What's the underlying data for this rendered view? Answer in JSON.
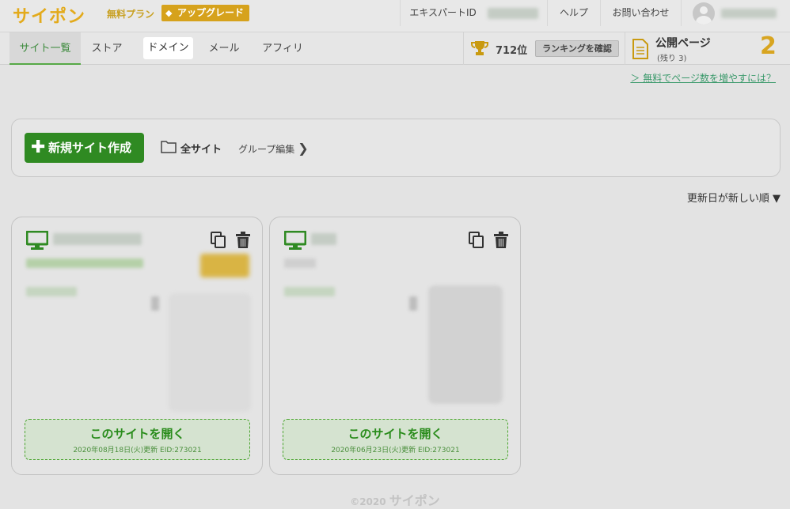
{
  "header": {
    "logo": "サイポン",
    "plan": "無料プラン",
    "upgrade": "アップグレード",
    "expert_id_label": "エキスパートID",
    "help": "ヘルプ",
    "contact": "お問い合わせ"
  },
  "nav": {
    "tabs": [
      {
        "label": "サイト一覧"
      },
      {
        "label": "ストア"
      },
      {
        "label": "ドメイン"
      },
      {
        "label": "メール"
      },
      {
        "label": "アフィリ"
      }
    ],
    "rank_value": "712位",
    "rank_button": "ランキングを確認",
    "published_title": "公開ページ",
    "published_remaining": "(残り 3)",
    "published_count": "2"
  },
  "help_link": "＞ 無料でページ数を増やすには？",
  "toolbar": {
    "new_site": "新規サイト作成",
    "all_sites": "全サイト",
    "group_edit": "グループ編集"
  },
  "sort_label": "更新日が新しい順 ▼",
  "cards": [
    {
      "open_label": "このサイトを開く",
      "meta": "2020年08月18日(火)更新 EID:273021"
    },
    {
      "open_label": "このサイトを開く",
      "meta": "2020年06月23日(火)更新 EID:273021"
    }
  ],
  "footer": {
    "copyright": "©2020",
    "brand": "サイポン"
  },
  "colors": {
    "green": "#2f8a22",
    "gold": "#d6a21c",
    "link": "#3c9a6c"
  }
}
